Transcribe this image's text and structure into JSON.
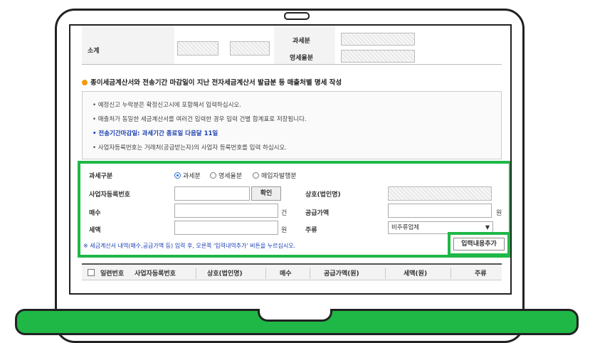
{
  "summary": {
    "subtotal_label": "소계",
    "taxable_label": "과세분",
    "zero_rated_label": "영세율분"
  },
  "section": {
    "title": "종이세금계산서와 전송기간 마감일이 지난 전자세금계산서 발급분 등 매출처별 명세 작성"
  },
  "notice": {
    "lines": [
      "• 예정신고 누락분은 확정신고시에 포함해서 입력하십시오.",
      "• 매출처가 동일한 세금계산서를 여러건 입력한 경우 입력 건별 합계표로 저장됩니다.",
      "• 전송기간마감일: 과세기간 종료일 다음달 11일",
      "• 사업자등록번호는 거래처(공급받는자)의 사업자 등록번호를 입력 하십시오."
    ]
  },
  "form": {
    "tax_type_label": "과세구분",
    "tax_type_options": [
      "과세분",
      "영세율분",
      "매입자발행분"
    ],
    "tax_type_selected": "과세분",
    "business_no_label": "사업자등록번호",
    "business_no_value": "",
    "confirm_button": "확인",
    "company_name_label": "상호(법인명)",
    "count_label": "매수",
    "count_unit": "건",
    "count_value": "",
    "supply_amount_label": "공급가액",
    "supply_amount_unit": "원",
    "supply_amount_value": "",
    "tax_label": "세액",
    "tax_unit": "원",
    "tax_value": "",
    "kind_label": "주류",
    "kind_selected": "비주류업체",
    "note": "※ 세금계산서 내역(매수,공급가액 등) 입력 후, 오른쪽 '입력내역추가' 버튼을 누르십시오.",
    "add_button": "입력내용추가"
  },
  "list": {
    "columns": [
      "일련번호",
      "사업자등록번호",
      "상호(법인명)",
      "매수",
      "공급가액(원)",
      "세액(원)",
      "주류"
    ]
  },
  "colors": {
    "accent_green": "#1fb847",
    "note_blue": "#1a3fb3",
    "section_icon": "#f39c12"
  }
}
